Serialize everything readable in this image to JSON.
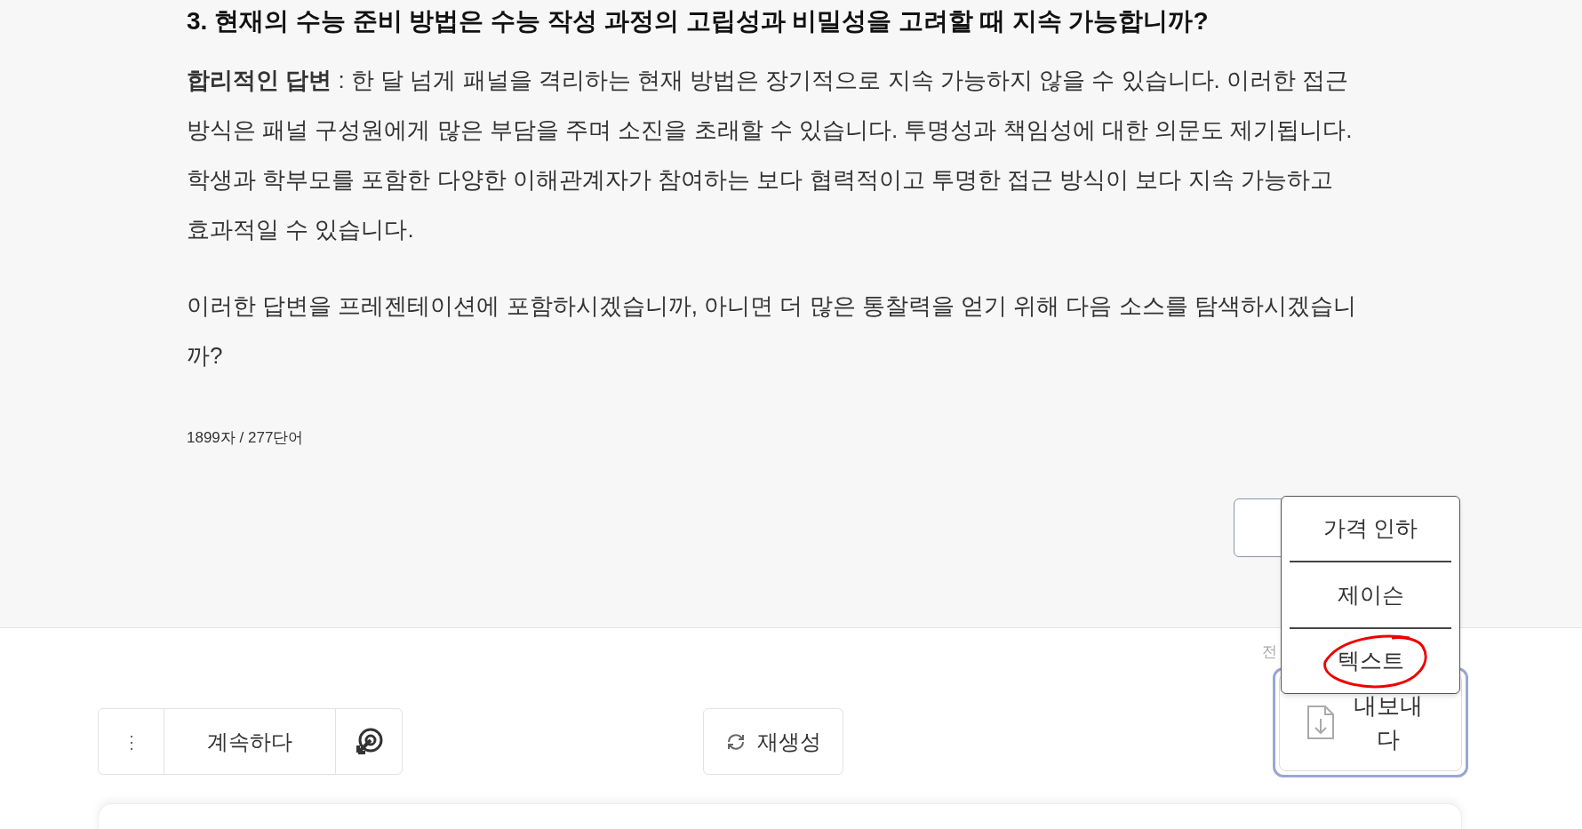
{
  "answer": {
    "heading": "3. 현재의 수능 준비 방법은 수능 작성 과정의 고립성과 비밀성을 고려할 때 지속 가능합니까?",
    "paragraphs": [
      "**합리적인 답변** : 한 달 넘게 패널을 격리하는 현재 방법은 장기적으로 지속 가능하지 않을 수 있습니다. 이러한 접근 방식은 패널 구성원에게 많은 부담을 주며 소진을 초래할 수 있습니다. 투명성과 책임성에 대한 의문도 제기됩니다. 학생과 학부모를 포함한 다양한 이해관계자가 참여하는 보다 협력적이고 투명한 접근 방식이 보다 지속 가능하고 효과적일 수 있습니다.",
      "이러한 답변을 프레젠테이션에 포함하시겠습니까, 아니면 더 많은 통찰력을 얻기 위해 다음 소스를 탐색하시겠습니까?"
    ],
    "count": "1899자 / 277단어"
  },
  "hint": "전",
  "export_menu": {
    "items": [
      {
        "label": "가격 인하",
        "circled": false
      },
      {
        "label": "제이슨",
        "circled": false
      },
      {
        "label": "텍스트",
        "circled": true
      }
    ]
  },
  "export_button": {
    "label": "내보내다",
    "focused": true
  },
  "toolbar": {
    "more": "⋮",
    "continue": "계속하다",
    "regenerate": "재생성"
  }
}
